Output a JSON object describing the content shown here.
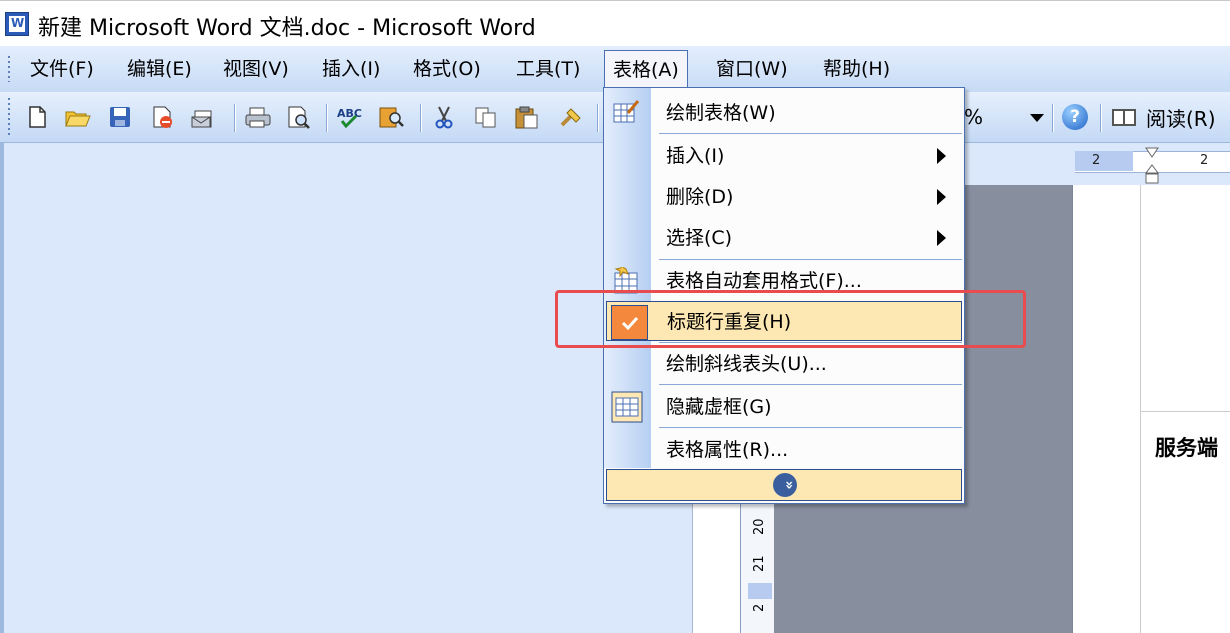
{
  "window": {
    "title": "新建 Microsoft Word 文档.doc - Microsoft Word",
    "app_icon": "word-doc-icon"
  },
  "menubar": {
    "items": [
      {
        "label": "文件(F)"
      },
      {
        "label": "编辑(E)"
      },
      {
        "label": "视图(V)"
      },
      {
        "label": "插入(I)"
      },
      {
        "label": "格式(O)"
      },
      {
        "label": "工具(T)"
      },
      {
        "label": "表格(A)",
        "open": true
      },
      {
        "label": "窗口(W)"
      },
      {
        "label": "帮助(H)"
      }
    ]
  },
  "toolbar": {
    "icons": [
      "new-document-icon",
      "open-icon",
      "save-icon",
      "permission-icon",
      "email-icon",
      "print-icon",
      "print-preview-icon",
      "spelling-icon",
      "research-icon",
      "cut-icon",
      "copy-icon",
      "paste-icon",
      "format-painter-icon"
    ],
    "zoom_suffix": "%",
    "help_glyph": "?",
    "read_label": "阅读(R)"
  },
  "table_menu": {
    "items": [
      {
        "label": "绘制表格(W)",
        "icon": "draw-table-icon"
      },
      {
        "label": "插入(I)",
        "submenu": true
      },
      {
        "label": "删除(D)",
        "submenu": true
      },
      {
        "label": "选择(C)",
        "submenu": true
      },
      {
        "label": "表格自动套用格式(F)...",
        "icon": "table-autoformat-icon"
      },
      {
        "label": "标题行重复(H)",
        "checked": true,
        "highlighted": true
      },
      {
        "label": "绘制斜线表头(U)..."
      },
      {
        "label": "隐藏虚框(G)",
        "icon": "hide-gridlines-icon"
      },
      {
        "label": "表格属性(R)..."
      }
    ],
    "expand_glyph": "»"
  },
  "rulers": {
    "horizontal_ticks": [
      "2",
      "2"
    ],
    "vertical_ticks": [
      "20",
      "21",
      "2"
    ]
  },
  "document": {
    "visible_text": "服务端"
  }
}
